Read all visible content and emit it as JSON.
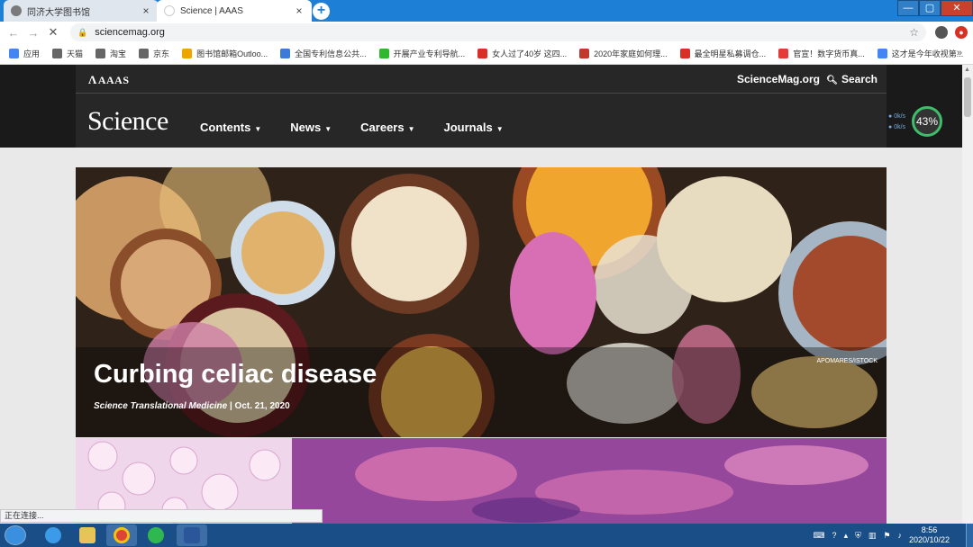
{
  "browser": {
    "tabs": [
      {
        "title": "同济大学图书馆",
        "close": "×",
        "active": false
      },
      {
        "title": "Science | AAAS",
        "close": "×",
        "active": true
      }
    ],
    "newtab_label": "+",
    "window_controls": {
      "minimize": "—",
      "maximize": "▢",
      "close": "✕"
    },
    "nav": {
      "back": "←",
      "forward": "→",
      "reload": "✕"
    },
    "url": "sciencemag.org",
    "bookmark_star": "☆",
    "bookmarks": [
      {
        "label": "应用",
        "color": "#4285f4"
      },
      {
        "label": "天猫",
        "color": "#666666"
      },
      {
        "label": "淘宝",
        "color": "#666666"
      },
      {
        "label": "京东",
        "color": "#666666"
      },
      {
        "label": "图书馆邮箱Outloo...",
        "color": "#f0a400"
      },
      {
        "label": "全国专利信息公共...",
        "color": "#3b7ad9"
      },
      {
        "label": "开展产业专利导航...",
        "color": "#2eb82e"
      },
      {
        "label": "女人过了40岁 这四...",
        "color": "#d93025"
      },
      {
        "label": "2020年家庭如何理...",
        "color": "#c0392b"
      },
      {
        "label": "最全明星私募调仓...",
        "color": "#d93025"
      },
      {
        "label": "官宣！数字货币真...",
        "color": "#e53935"
      },
      {
        "label": "这才是今年收视第...",
        "color": "#4285f4"
      }
    ],
    "bookmarks_more": "»",
    "status": "正在连接..."
  },
  "site": {
    "aaas_label": "AAAS",
    "sciencemag_label": "ScienceMag.org",
    "search_label": "Search",
    "logo": "Science",
    "menu": [
      {
        "label": "Contents"
      },
      {
        "label": "News"
      },
      {
        "label": "Careers"
      },
      {
        "label": "Journals"
      }
    ],
    "hero": {
      "title": "Curbing celiac disease",
      "journal": "Science Translational Medicine",
      "date": " | Oct. 21, 2020",
      "credit": "APOMARES/ISTOCK"
    }
  },
  "net_widget": {
    "up": "0k/s",
    "down": "0k/s",
    "percent": "43%"
  },
  "taskbar": {
    "time": "8:56",
    "date": "2020/10/22"
  },
  "colors": {
    "tabstrip": "#1e7fd6",
    "site_header": "#272727",
    "taskbar": "#1a4e86"
  }
}
